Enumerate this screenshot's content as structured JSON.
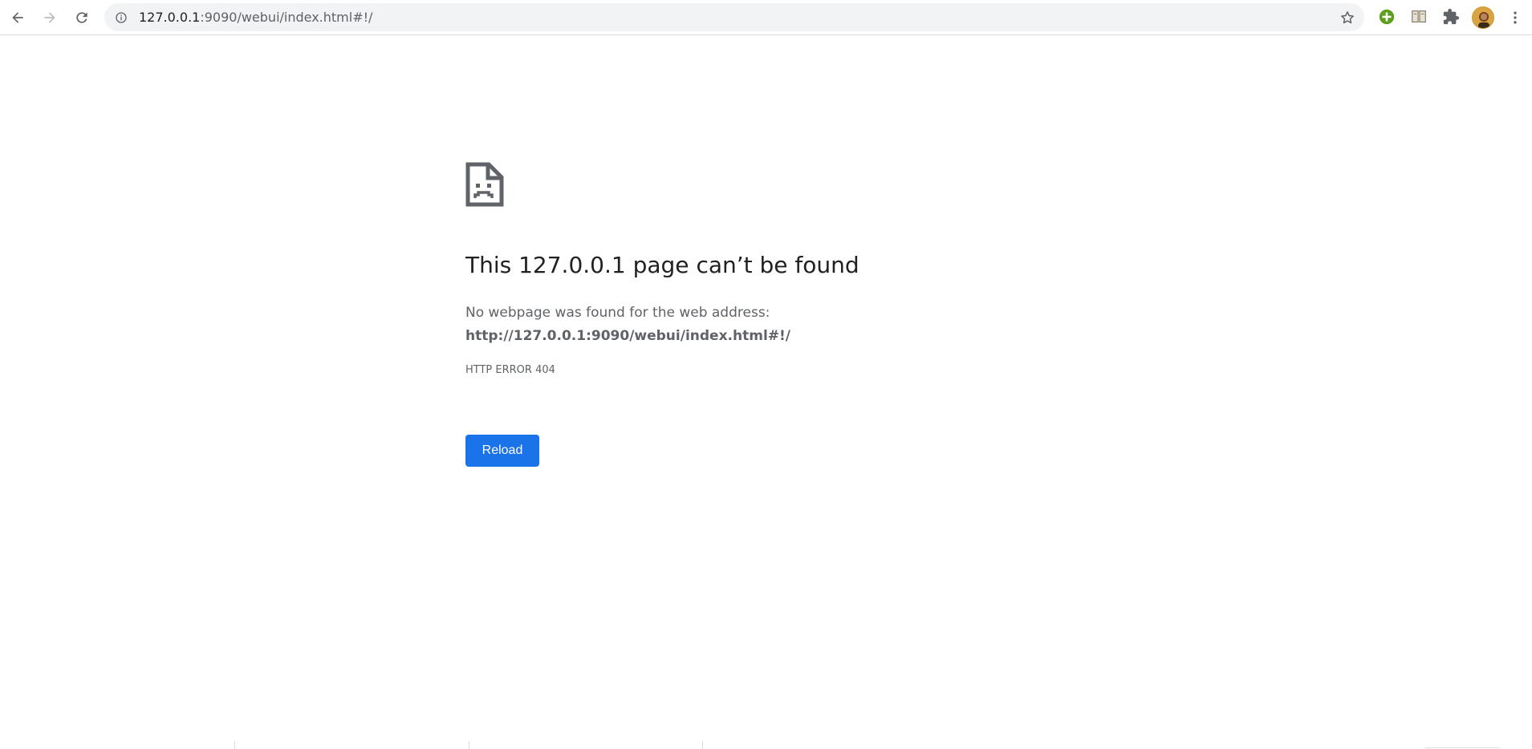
{
  "browser": {
    "url_host": "127.0.0.1",
    "url_rest": ":9090/webui/index.html#!/",
    "icons": {
      "back": "arrow-back-icon",
      "forward": "arrow-forward-icon",
      "reload": "reload-icon",
      "info": "info-icon",
      "star": "star-icon",
      "extension_green": "plus-circle-icon",
      "extension_book": "reading-list-icon",
      "extensions": "puzzle-icon",
      "menu": "kebab-menu-icon"
    }
  },
  "error_page": {
    "title": "This 127.0.0.1 page can’t be found",
    "description": "No webpage was found for the web address:",
    "url": "http://127.0.0.1:9090/webui/index.html#!/",
    "error_code": "HTTP ERROR 404",
    "reload_label": "Reload"
  },
  "colors": {
    "accent": "#1a73e8",
    "text_primary": "#202124",
    "text_secondary": "#5f6368",
    "omnibox_bg": "#f1f3f4"
  }
}
